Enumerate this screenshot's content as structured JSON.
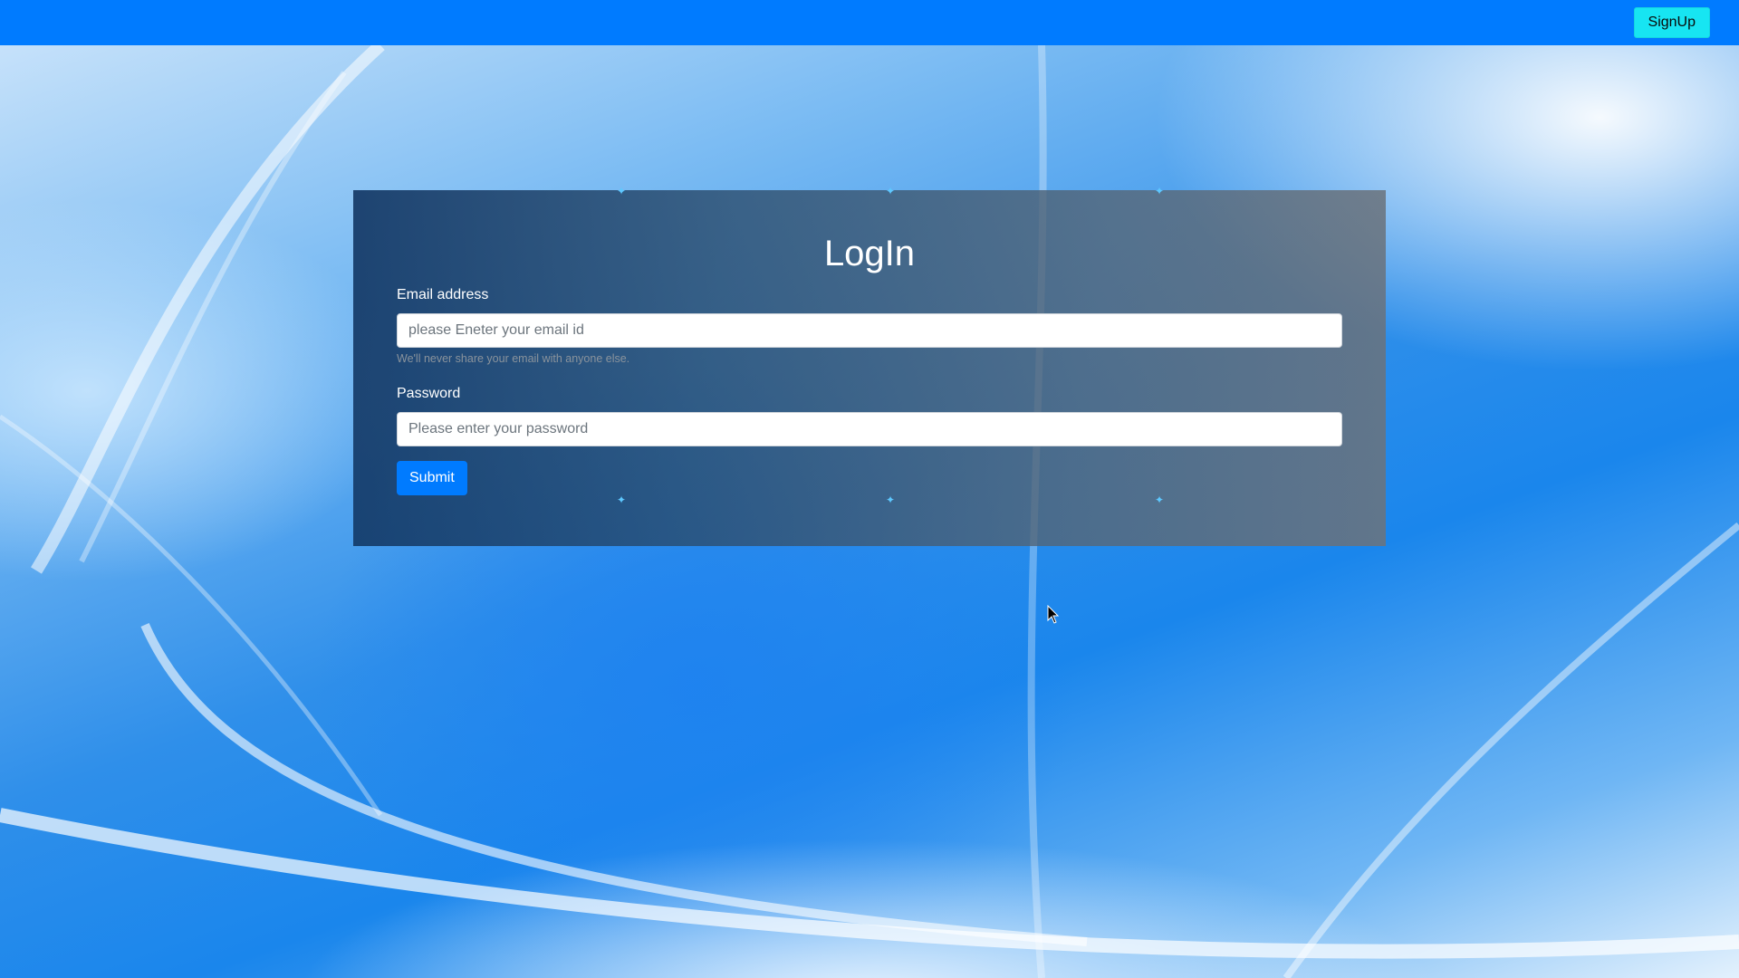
{
  "navbar": {
    "signup_label": "SignUp"
  },
  "login": {
    "title": "LogIn",
    "email_label": "Email address",
    "email_placeholder": "please Eneter your email id",
    "email_help": "We'll never share your email with anyone else.",
    "password_label": "Password",
    "password_placeholder": "Please enter your password",
    "submit_label": "Submit"
  },
  "colors": {
    "navbar": "#007bff",
    "signup_button": "#17e5f2",
    "submit_button": "#007bff"
  },
  "icons": {
    "sparkle": "sparkle-icon",
    "cursor": "mouse-pointer-icon"
  }
}
